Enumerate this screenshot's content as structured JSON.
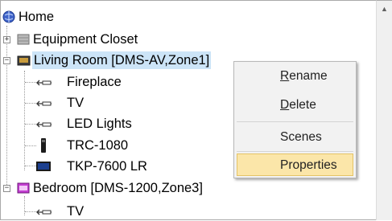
{
  "tree": {
    "nodes": [
      {
        "label": "Home",
        "icon": "globe-icon"
      },
      {
        "label": "Equipment Closet",
        "icon": "closet-icon"
      },
      {
        "label": "Living Room [DMS-AV,Zone1]",
        "icon": "room-icon"
      },
      {
        "label": "Fireplace",
        "icon": "ir-emitter-icon"
      },
      {
        "label": "TV",
        "icon": "ir-emitter-icon"
      },
      {
        "label": "LED Lights",
        "icon": "ir-emitter-icon"
      },
      {
        "label": "TRC-1080",
        "icon": "remote-icon"
      },
      {
        "label": "TKP-7600 LR",
        "icon": "touchpanel-icon"
      },
      {
        "label": "Bedroom [DMS-1200,Zone3]",
        "icon": "room-icon-purple"
      },
      {
        "label": "TV",
        "icon": "ir-emitter-icon"
      }
    ]
  },
  "context_menu": {
    "items": [
      {
        "label": "Rename",
        "accel": "R",
        "rest": "ename"
      },
      {
        "label": "Delete",
        "accel": "D",
        "rest": "elete"
      },
      {
        "label": "Scenes"
      },
      {
        "label": "Properties"
      }
    ],
    "highlighted": "Properties"
  },
  "colors": {
    "selection": "#cce4f7",
    "menu_highlight": "#fbe6a9"
  }
}
